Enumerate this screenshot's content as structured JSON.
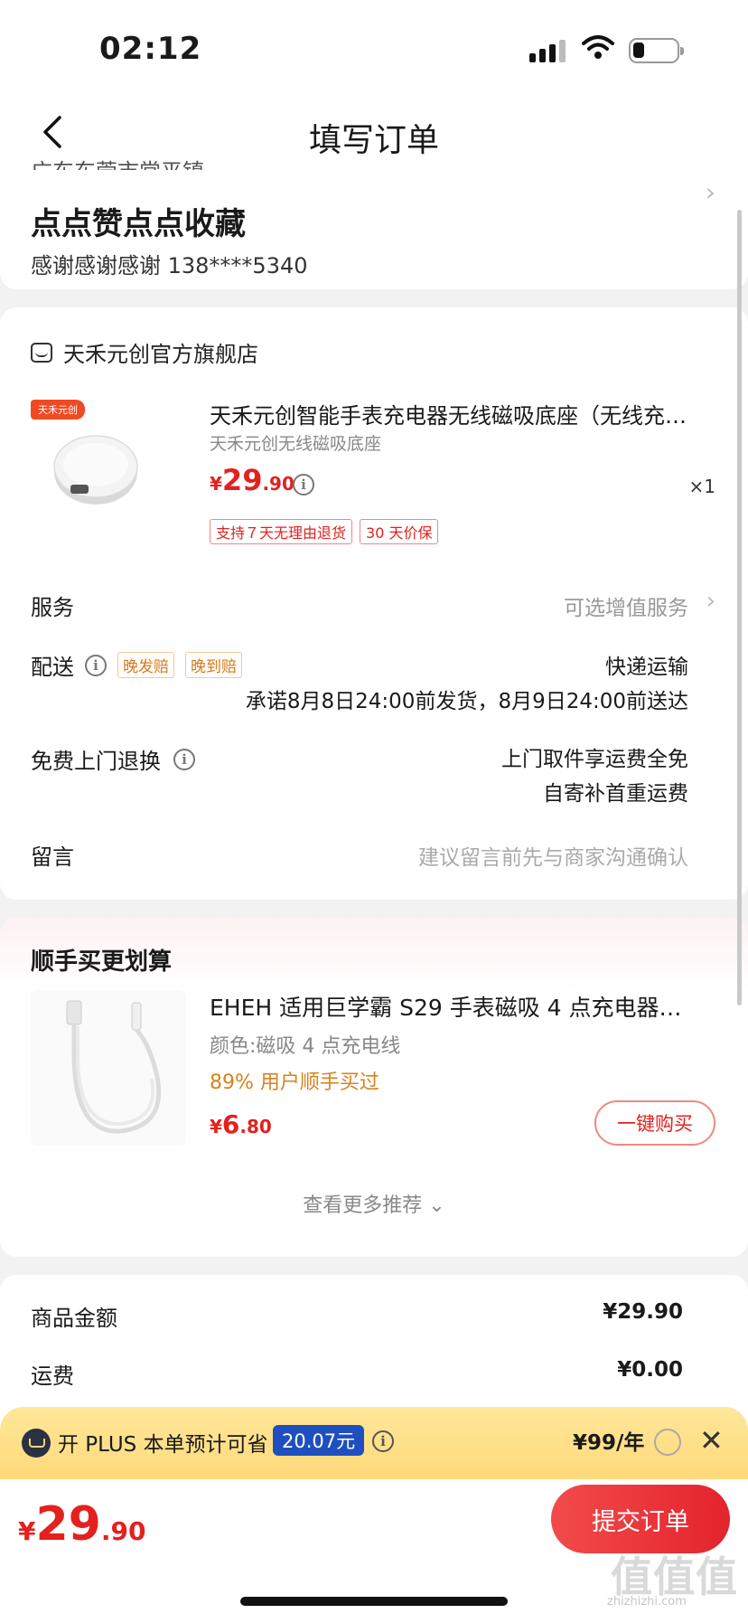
{
  "status": {
    "time": "02:12"
  },
  "nav": {
    "title": "填写订单"
  },
  "address": {
    "cut_line": "广东东莞市常平镇",
    "name": "点点赞点点收藏",
    "contact": "感谢感谢感谢  138****5340"
  },
  "order": {
    "shop_name": "天禾元创官方旗舰店",
    "brand_tag": "天禾元创",
    "product_title": "天禾元创智能手表充电器无线磁吸底座（无线充…",
    "product_spec": "天禾元创无线磁吸底座",
    "price_symbol": "¥",
    "price_int": "29",
    "price_dec": ".90",
    "quantity": "×1",
    "tags": [
      "支持７天无理由退货",
      "30 天价保"
    ],
    "service_label": "服务",
    "service_value": "可选增值服务",
    "delivery_label": "配送",
    "delivery_tags": [
      "晚发赔",
      "晚到赔"
    ],
    "delivery_method": "快递运输",
    "delivery_promise": "承诺8月8日24:00前发货，8月9日24:00前送达",
    "return_label": "免费上门退换",
    "return_line1": "上门取件享运费全免",
    "return_line2": "自寄补首重运费",
    "message_label": "留言",
    "message_placeholder": "建议留言前先与商家沟通确认"
  },
  "recommend": {
    "title": "顺手买更划算",
    "item_name": "EHEH 适用巨学霸 S29 手表磁吸 4 点充电器…",
    "item_spec": "颜色:磁吸 4 点充电线",
    "item_pct": "89% 用户顺手买过",
    "price_symbol": "¥",
    "price_int": "6",
    "price_dec": ".80",
    "buy_label": "一键购买",
    "more_label": "查看更多推荐 ⌄"
  },
  "summary": {
    "goods_label": "商品金额",
    "goods_value": "¥29.90",
    "freight_label": "运费",
    "freight_value": "¥0.00"
  },
  "plus": {
    "text": "开 PLUS 本单预计可省",
    "save_badge": "20.07元",
    "price": "¥99/年"
  },
  "bottom": {
    "price_symbol": "¥",
    "price_int": "29",
    "price_dec": ".90",
    "submit_label": "提交订单",
    "watermark": "值值值",
    "watermark_url": "zhizhizhi.com"
  },
  "colors": {
    "accent": "#e3211e",
    "plus_bg": "#ffd97a",
    "badge_blue": "#1e4fbf"
  }
}
